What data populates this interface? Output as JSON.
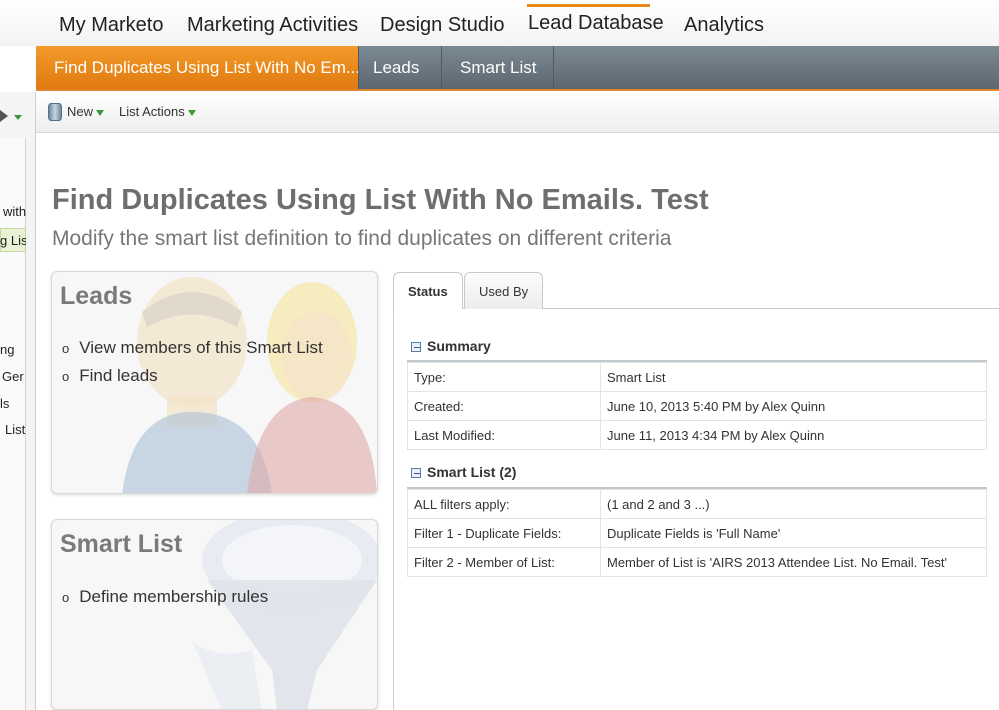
{
  "top_nav": {
    "items": [
      {
        "label": "My Marketo"
      },
      {
        "label": "Marketing Activities"
      },
      {
        "label": "Design Studio"
      },
      {
        "label": "Lead Database"
      },
      {
        "label": "Analytics"
      }
    ],
    "active": "Lead Database",
    "accent_color": "#e88a1a"
  },
  "sub_tabs": {
    "active_label": "Find Duplicates Using List With No Em...",
    "tabs": [
      "Leads",
      "Smart List"
    ]
  },
  "toolbar": {
    "new_label": "New",
    "list_actions_label": "List Actions"
  },
  "left_panel": {
    "fragments": [
      "with",
      "g Lis",
      "ng",
      "Ger",
      "ls",
      "List"
    ]
  },
  "page": {
    "title": "Find Duplicates Using List With No Emails. Test",
    "subtitle": "Modify the smart list definition to find duplicates on different criteria"
  },
  "cards": {
    "leads": {
      "title": "Leads",
      "links": [
        "View members of this Smart List",
        "Find leads"
      ]
    },
    "smart_list": {
      "title": "Smart List",
      "links": [
        "Define membership rules"
      ]
    }
  },
  "detail_tabs": {
    "status": "Status",
    "used_by": "Used By"
  },
  "summary": {
    "heading": "Summary",
    "rows": [
      {
        "key": "Type:",
        "value": "Smart List"
      },
      {
        "key": "Created:",
        "value": "June 10, 2013 5:40 PM by Alex Quinn"
      },
      {
        "key": "Last Modified:",
        "value": "June 11, 2013 4:34 PM by Alex Quinn"
      }
    ]
  },
  "smart_list_section": {
    "heading": "Smart List (2)",
    "rows": [
      {
        "key": "ALL filters apply:",
        "value": "(1 and 2 and 3 ...)"
      },
      {
        "key": "Filter 1 - Duplicate Fields:",
        "value": "Duplicate Fields is 'Full Name'"
      },
      {
        "key": "Filter 2 - Member of List:",
        "value": "Member of List is 'AIRS 2013 Attendee List. No Email. Test'"
      }
    ]
  }
}
